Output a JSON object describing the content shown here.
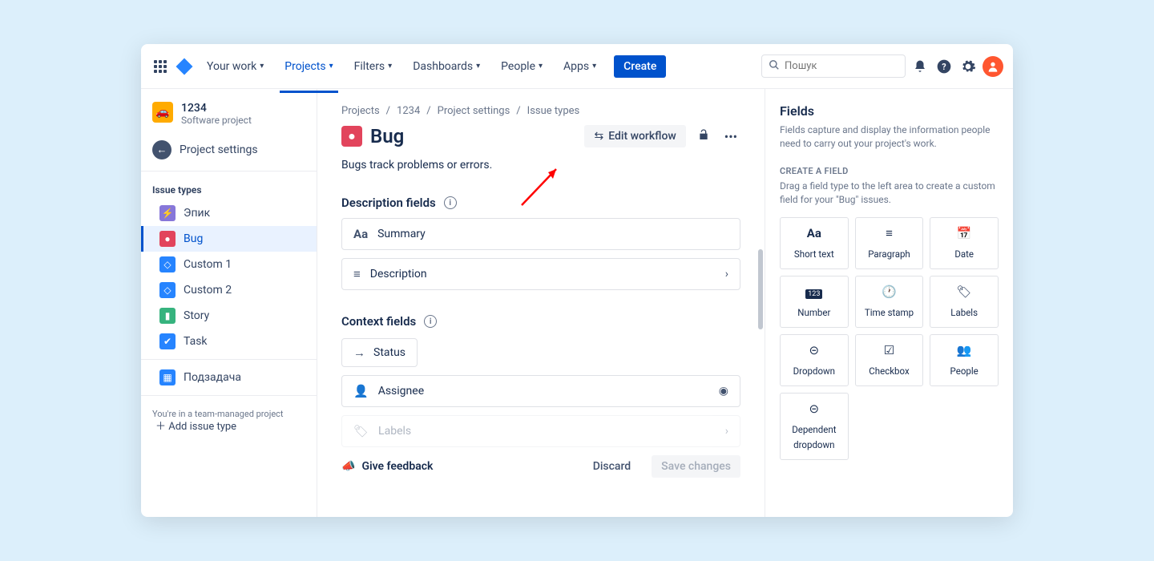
{
  "topnav": {
    "your_work": "Your work",
    "projects": "Projects",
    "filters": "Filters",
    "dashboards": "Dashboards",
    "people": "People",
    "apps": "Apps",
    "create": "Create",
    "search_placeholder": "Пошук"
  },
  "sidebar": {
    "project_name": "1234",
    "project_type": "Software project",
    "back_link": "Project settings",
    "issue_types_heading": "Issue types",
    "items": [
      {
        "label": "Эпик"
      },
      {
        "label": "Bug"
      },
      {
        "label": "Custom 1"
      },
      {
        "label": "Custom 2"
      },
      {
        "label": "Story"
      },
      {
        "label": "Task"
      }
    ],
    "subtask": "Подзадача",
    "add_issue_type": "Add issue type",
    "footer_note": "You're in a team-managed project"
  },
  "breadcrumbs": {
    "a": "Projects",
    "b": "1234",
    "c": "Project settings",
    "d": "Issue types"
  },
  "content": {
    "title": "Bug",
    "edit_workflow": "Edit workflow",
    "description": "Bugs track problems or errors.",
    "section_description_fields": "Description fields",
    "field_summary": "Summary",
    "field_description": "Description",
    "section_context_fields": "Context fields",
    "field_status": "Status",
    "field_assignee": "Assignee",
    "field_labels": "Labels",
    "give_feedback": "Give feedback",
    "discard": "Discard",
    "save": "Save changes"
  },
  "right_panel": {
    "title": "Fields",
    "subtitle": "Fields capture and display the information people need to carry out your project's work.",
    "caption": "CREATE A FIELD",
    "hint": "Drag a field type to the left area to create a custom field for your \"Bug\" issues.",
    "tiles": [
      {
        "label": "Short text"
      },
      {
        "label": "Paragraph"
      },
      {
        "label": "Date"
      },
      {
        "label": "Number"
      },
      {
        "label": "Time stamp"
      },
      {
        "label": "Labels"
      },
      {
        "label": "Dropdown"
      },
      {
        "label": "Checkbox"
      },
      {
        "label": "People"
      },
      {
        "label": "Dependent dropdown"
      }
    ]
  }
}
